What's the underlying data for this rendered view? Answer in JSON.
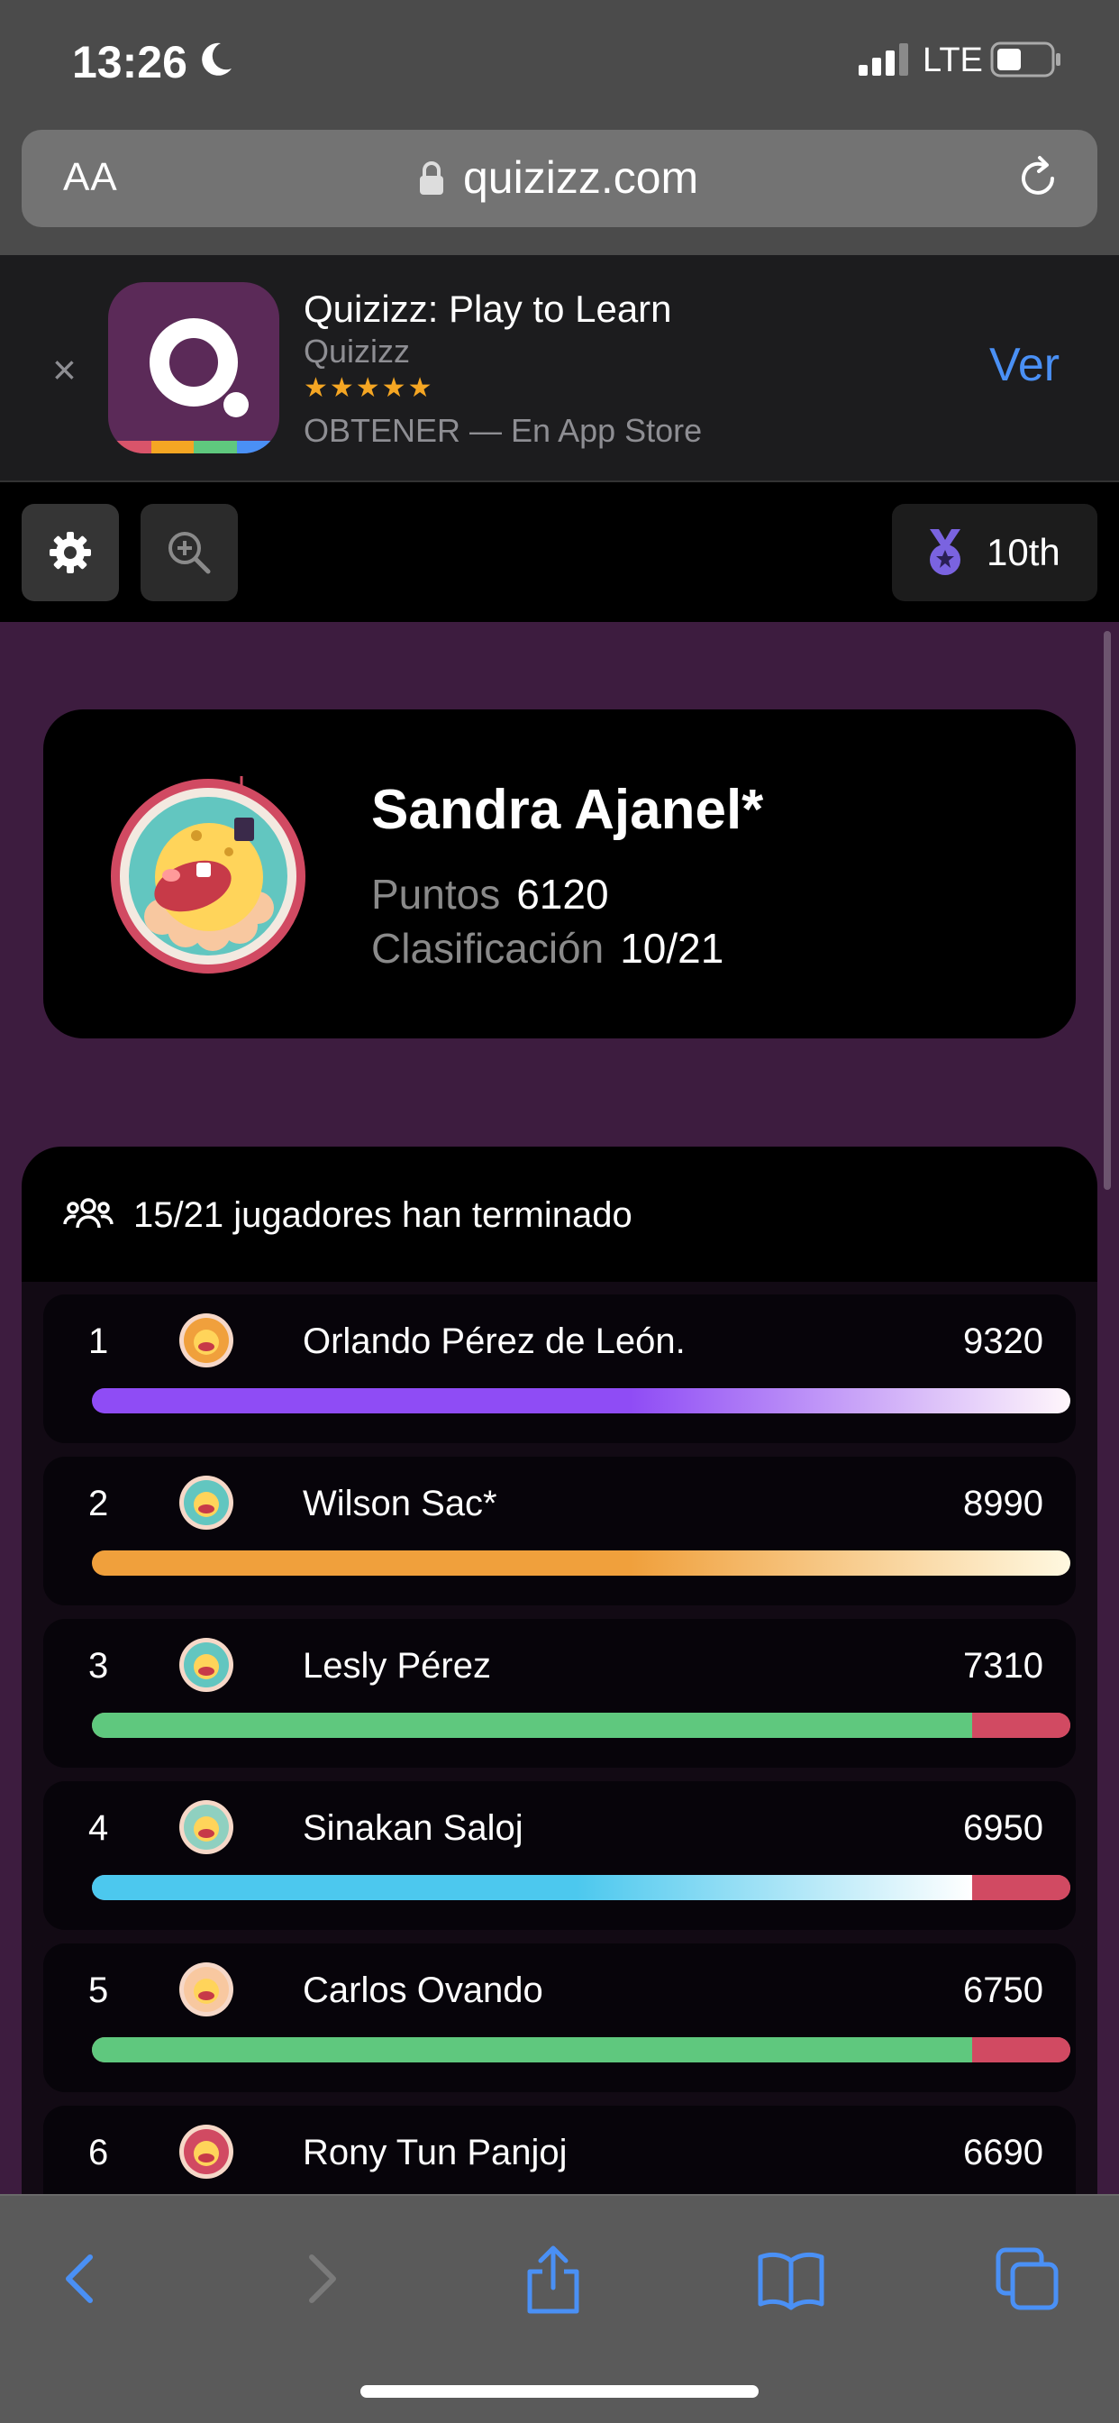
{
  "status_bar": {
    "time": "13:26",
    "network": "LTE"
  },
  "browser": {
    "text_size_label": "AA",
    "url": "quizizz.com"
  },
  "app_banner": {
    "app_name": "Quizizz: Play to Learn",
    "developer": "Quizizz",
    "stars": "★★★★★",
    "get_text": "OBTENER — En App Store",
    "view_label": "Ver",
    "close_label": "×"
  },
  "quiz_toolbar": {
    "rank_label": "10th"
  },
  "player": {
    "name": "Sandra Ajanel*",
    "points_label": "Puntos",
    "points": "6120",
    "rank_label": "Clasificación",
    "rank": "10/21"
  },
  "leaderboard": {
    "header": "15/21 jugadores han terminado",
    "rows": [
      {
        "rank": "1",
        "name": "Orlando Pérez de León.",
        "score": "9320",
        "correct_fraction": 1.0,
        "bar_color": "#8f4cf5",
        "bar_end": "#fff6fb",
        "avatar": "ice-cream-mask-avatar"
      },
      {
        "rank": "2",
        "name": "Wilson Sac*",
        "score": "8990",
        "correct_fraction": 1.0,
        "bar_color": "#f0a03c",
        "bar_end": "#fff8e0",
        "avatar": "lightbulb-avatar"
      },
      {
        "rank": "3",
        "name": "Lesly Pérez",
        "score": "7310",
        "correct_fraction": 0.9,
        "bar_color": "#5fc87e",
        "bar_end": "#5fc87e",
        "avatar": "monster-avatar"
      },
      {
        "rank": "4",
        "name": "Sinakan Saloj",
        "score": "6950",
        "correct_fraction": 0.9,
        "bar_color": "#4cc8ee",
        "bar_end": "#ffffff",
        "avatar": "wizard-avatar"
      },
      {
        "rank": "5",
        "name": "Carlos Ovando",
        "score": "6750",
        "correct_fraction": 0.9,
        "bar_color": "#5fc87e",
        "bar_end": "#5fc87e",
        "avatar": "ice-cream-cone-avatar"
      },
      {
        "rank": "6",
        "name": "Rony Tun Panjoj",
        "score": "6690",
        "correct_fraction": 0.9,
        "bar_color": "#5fc87e",
        "bar_end": "#5fc87e",
        "avatar": "robot-avatar"
      }
    ]
  },
  "colors": {
    "page_background": "#3d1c3f",
    "wrong_answer": "#d14a62",
    "link_blue": "#4a90f5"
  }
}
